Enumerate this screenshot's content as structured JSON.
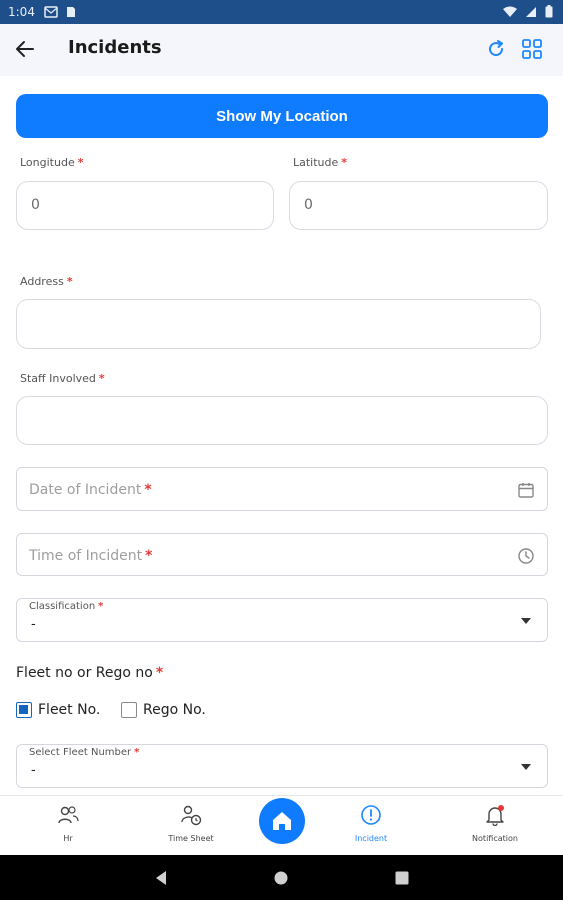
{
  "status_bar": {
    "time": "1:04"
  },
  "app_bar": {
    "title": "Incidents"
  },
  "actions": {
    "show_location": "Show My Location"
  },
  "form": {
    "longitude": {
      "label": "Longitude",
      "value": "0"
    },
    "latitude": {
      "label": "Latitude",
      "value": "0"
    },
    "address": {
      "label": "Address",
      "value": ""
    },
    "staff_involved": {
      "label": "Staff Involved",
      "value": ""
    },
    "date_of_incident": {
      "placeholder": "Date of Incident"
    },
    "time_of_incident": {
      "placeholder": "Time of Incident"
    },
    "classification": {
      "label": "Classification",
      "value": "-"
    },
    "fleet_or_rego": {
      "title": "Fleet no or Rego no",
      "options": [
        {
          "label": "Fleet No.",
          "checked": true
        },
        {
          "label": "Rego No.",
          "checked": false
        }
      ]
    },
    "select_fleet_number": {
      "label": "Select Fleet Number",
      "value": "-"
    },
    "required_mark": "*"
  },
  "bottom_nav": {
    "items": [
      {
        "label": "Hr",
        "icon": "people-icon",
        "active": false
      },
      {
        "label": "Time Sheet",
        "icon": "timesheet-icon",
        "active": false
      },
      {
        "label": "",
        "icon": "home-icon",
        "active": false
      },
      {
        "label": "Incident",
        "icon": "alert-circle-icon",
        "active": true
      },
      {
        "label": "Notification",
        "icon": "bell-icon",
        "active": false
      }
    ]
  },
  "colors": {
    "primary": "#0f7bff",
    "status_bar": "#1f4f8a",
    "required": "#e53935",
    "active_nav": "#1e88ff"
  }
}
